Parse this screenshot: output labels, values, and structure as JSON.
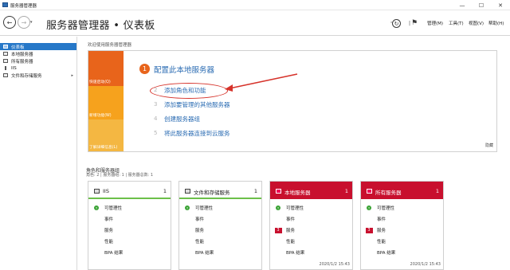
{
  "window": {
    "title": "服务器管理器",
    "minimize": "—",
    "maximize": "☐",
    "close": "✕"
  },
  "header": {
    "breadcrumb_app": "服务器管理器",
    "breadcrumb_sep": "•",
    "breadcrumb_page": "仪表板",
    "menus": [
      "管理(M)",
      "工具(T)",
      "视图(V)",
      "帮助(H)"
    ]
  },
  "sidebar": {
    "items": [
      {
        "label": "仪表板",
        "active": true
      },
      {
        "label": "本地服务器",
        "active": false
      },
      {
        "label": "所有服务器",
        "active": false
      },
      {
        "label": "IIS",
        "active": false
      },
      {
        "label": "文件和存储服务",
        "active": false,
        "chevron": "▸"
      }
    ]
  },
  "welcome": {
    "title": "欢迎使用服务器管理器",
    "side_labels": [
      "快速启动(Q)",
      "新增功能(W)",
      "了解详细信息(L)"
    ],
    "step1_number": "1",
    "step1_text": "配置此本地服务器",
    "steps": [
      {
        "num": "2",
        "text": "添加角色和功能"
      },
      {
        "num": "3",
        "text": "添加要管理的其他服务器"
      },
      {
        "num": "4",
        "text": "创建服务器组"
      },
      {
        "num": "5",
        "text": "将此服务器连接到云服务"
      }
    ],
    "hide": "隐藏"
  },
  "roles": {
    "title": "角色和服务器组",
    "subtitle": "角色: 2 | 服务器组: 1 | 服务器总数: 1",
    "cards": [
      {
        "title": "IIS",
        "count": "1",
        "alert": false,
        "rows": [
          {
            "label": "可管理性",
            "indicator": "ok"
          },
          {
            "label": "事件",
            "indicator": ""
          },
          {
            "label": "服务",
            "indicator": ""
          },
          {
            "label": "性能",
            "indicator": ""
          },
          {
            "label": "BPA 结果",
            "indicator": ""
          }
        ],
        "time": ""
      },
      {
        "title": "文件和存储服务",
        "count": "1",
        "alert": false,
        "rows": [
          {
            "label": "可管理性",
            "indicator": "ok"
          },
          {
            "label": "事件",
            "indicator": ""
          },
          {
            "label": "服务",
            "indicator": ""
          },
          {
            "label": "性能",
            "indicator": ""
          },
          {
            "label": "BPA 结果",
            "indicator": ""
          }
        ],
        "time": ""
      },
      {
        "title": "本地服务器",
        "count": "1",
        "alert": true,
        "rows": [
          {
            "label": "可管理性",
            "indicator": "ok"
          },
          {
            "label": "事件",
            "indicator": ""
          },
          {
            "label": "服务",
            "indicator": "3"
          },
          {
            "label": "性能",
            "indicator": ""
          },
          {
            "label": "BPA 结果",
            "indicator": ""
          }
        ],
        "time": "2020/1/2 15:43"
      },
      {
        "title": "所有服务器",
        "count": "1",
        "alert": true,
        "rows": [
          {
            "label": "可管理性",
            "indicator": "ok"
          },
          {
            "label": "事件",
            "indicator": ""
          },
          {
            "label": "服务",
            "indicator": "3"
          },
          {
            "label": "性能",
            "indicator": ""
          },
          {
            "label": "BPA 结果",
            "indicator": ""
          }
        ],
        "time": "2020/1/2 15:43"
      }
    ]
  },
  "colors": {
    "accent_blue": "#2778c8",
    "orange": "#e8641b",
    "alert_red": "#c8102e",
    "ok_green": "#3aa335",
    "annotation_red": "#d6322a"
  }
}
